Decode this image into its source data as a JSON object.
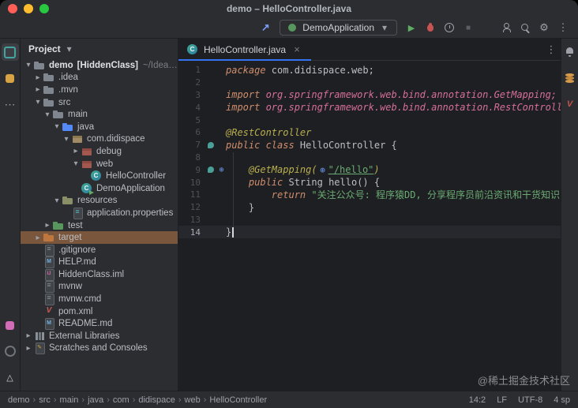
{
  "window": {
    "title": "demo – HelloController.java"
  },
  "toolbar": {
    "run_config": "DemoApplication",
    "pre_combo_icons": [
      "build-arrow"
    ],
    "post_combo_icons": [
      "run",
      "debug",
      "profiler",
      "stop"
    ],
    "right_icons": [
      "user",
      "search",
      "settings",
      "more-vertical"
    ]
  },
  "activity_bar_left": {
    "top": [
      "project",
      "commit",
      "more-horizontal"
    ],
    "bottom": [
      "services",
      "run-circle",
      "problems"
    ],
    "active": "project"
  },
  "activity_bar_right": {
    "top": [
      "notifications",
      "database",
      "maven"
    ]
  },
  "project": {
    "header": "Project",
    "tree": [
      {
        "label": "demo",
        "suffix": "[HiddenClass]",
        "hint": "~/IdeaProject...",
        "indent": 0,
        "chevron": "down",
        "icon": "folder",
        "bold": true
      },
      {
        "label": ".idea",
        "indent": 1,
        "chevron": "right",
        "icon": "folder"
      },
      {
        "label": ".mvn",
        "indent": 1,
        "chevron": "right",
        "icon": "folder"
      },
      {
        "label": "src",
        "indent": 1,
        "chevron": "down",
        "icon": "folder"
      },
      {
        "label": "main",
        "indent": 2,
        "chevron": "down",
        "icon": "folder"
      },
      {
        "label": "java",
        "indent": 3,
        "chevron": "down",
        "icon": "folder-source"
      },
      {
        "label": "com.didispace",
        "indent": 4,
        "chevron": "down",
        "icon": "package"
      },
      {
        "label": "debug",
        "indent": 5,
        "chevron": "right",
        "icon": "package-red"
      },
      {
        "label": "web",
        "indent": 5,
        "chevron": "down",
        "icon": "package-red"
      },
      {
        "label": "HelloController",
        "indent": 6,
        "icon": "class"
      },
      {
        "label": "DemoApplication",
        "indent": 5,
        "icon": "class-run"
      },
      {
        "label": "resources",
        "indent": 3,
        "chevron": "down",
        "icon": "folder-resources"
      },
      {
        "label": "application.properties",
        "indent": 4,
        "icon": "file-properties"
      },
      {
        "label": "test",
        "indent": 2,
        "chevron": "right",
        "icon": "folder-test"
      },
      {
        "label": "target",
        "indent": 1,
        "chevron": "right",
        "icon": "folder-excluded",
        "selected": true
      },
      {
        "label": ".gitignore",
        "indent": 1,
        "icon": "file-git"
      },
      {
        "label": "HELP.md",
        "indent": 1,
        "icon": "file-md"
      },
      {
        "label": "HiddenClass.iml",
        "indent": 1,
        "icon": "file-iml"
      },
      {
        "label": "mvnw",
        "indent": 1,
        "icon": "file-text"
      },
      {
        "label": "mvnw.cmd",
        "indent": 1,
        "icon": "file-text"
      },
      {
        "label": "pom.xml",
        "indent": 1,
        "icon": "file-maven"
      },
      {
        "label": "README.md",
        "indent": 1,
        "icon": "file-md"
      },
      {
        "label": "External Libraries",
        "indent": 0,
        "chevron": "right",
        "icon": "libraries"
      },
      {
        "label": "Scratches and Consoles",
        "indent": 0,
        "chevron": "right",
        "icon": "scratches"
      }
    ]
  },
  "editor": {
    "tab": {
      "label": "HelloController.java",
      "icon": "java-class",
      "close_icon": "close"
    },
    "inspection_icon": "check",
    "lines": [
      {
        "n": 1,
        "tokens": [
          {
            "t": "package ",
            "c": "kw"
          },
          {
            "t": "com.didispace.web;",
            "c": "pl"
          }
        ]
      },
      {
        "n": 2,
        "tokens": []
      },
      {
        "n": 3,
        "tokens": [
          {
            "t": "import ",
            "c": "kw"
          },
          {
            "t": "org.springframework.web.bind.annotation.GetMapping;",
            "c": "imp"
          }
        ]
      },
      {
        "n": 4,
        "tokens": [
          {
            "t": "import ",
            "c": "kw"
          },
          {
            "t": "org.springframework.web.bind.annotation.RestController;",
            "c": "imp"
          }
        ]
      },
      {
        "n": 5,
        "tokens": []
      },
      {
        "n": 6,
        "tokens": [
          {
            "t": "@RestController",
            "c": "ann"
          }
        ]
      },
      {
        "n": 7,
        "tokens": [
          {
            "t": "public class ",
            "c": "kw"
          },
          {
            "t": "HelloController ",
            "c": "cls"
          },
          {
            "t": "{",
            "c": "pl"
          }
        ],
        "gutter": [
          "bean"
        ]
      },
      {
        "n": 8,
        "tokens": []
      },
      {
        "n": 9,
        "tokens": [
          {
            "t": "    ",
            "c": "pl"
          },
          {
            "t": "@GetMapping(",
            "c": "ann"
          },
          {
            "icon": "globe"
          },
          {
            "t": "\"/hello\"",
            "c": "str-link"
          },
          {
            "t": ")",
            "c": "ann"
          }
        ],
        "gutter": [
          "bean",
          "globe"
        ]
      },
      {
        "n": 10,
        "tokens": [
          {
            "t": "    ",
            "c": "pl"
          },
          {
            "t": "public ",
            "c": "kw"
          },
          {
            "t": "String ",
            "c": "pl"
          },
          {
            "t": "hello",
            "c": "meth"
          },
          {
            "t": "() {",
            "c": "pl"
          }
        ]
      },
      {
        "n": 11,
        "tokens": [
          {
            "t": "        ",
            "c": "pl"
          },
          {
            "t": "return ",
            "c": "kw"
          },
          {
            "t": "\"关注公众号: 程序猿DD, 分享程序员前沿资讯和干货知识\"",
            "c": "str"
          },
          {
            "t": ";",
            "c": "pl"
          }
        ]
      },
      {
        "n": 12,
        "tokens": [
          {
            "t": "    }",
            "c": "pl"
          }
        ]
      },
      {
        "n": 13,
        "tokens": []
      },
      {
        "n": 14,
        "tokens": [
          {
            "t": "}",
            "c": "pl"
          }
        ],
        "current": true,
        "cursor": true
      }
    ]
  },
  "status_bar": {
    "breadcrumbs": [
      "demo",
      "src",
      "main",
      "java",
      "com",
      "didispace",
      "web",
      "HelloController"
    ],
    "separator": "›",
    "right": [
      "14:2",
      "LF",
      "UTF-8",
      "4 sp"
    ],
    "watermark": "@稀土掘金技术社区"
  },
  "colors": {
    "accent_blue": "#3574f0",
    "run_green": "#5fad65",
    "selected_row_orange": "#7a563c",
    "keyword_orange": "#cf8e6d",
    "import_pink": "#d56f9b",
    "annotation_yellow": "#b8ae4f",
    "string_green": "#6aab73",
    "editor_bg": "#1e1f22",
    "panel_bg": "#2b2d30"
  }
}
